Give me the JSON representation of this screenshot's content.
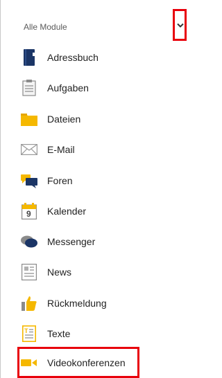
{
  "header": {
    "title": "Alle Module"
  },
  "modules": [
    {
      "label": "Adressbuch",
      "icon": "address-book-icon"
    },
    {
      "label": "Aufgaben",
      "icon": "clipboard-icon"
    },
    {
      "label": "Dateien",
      "icon": "folder-icon"
    },
    {
      "label": "E-Mail",
      "icon": "envelope-icon"
    },
    {
      "label": "Foren",
      "icon": "forum-icon"
    },
    {
      "label": "Kalender",
      "icon": "calendar-icon"
    },
    {
      "label": "Messenger",
      "icon": "chat-bubbles-icon"
    },
    {
      "label": "News",
      "icon": "newspaper-icon"
    },
    {
      "label": "Rückmeldung",
      "icon": "thumbs-up-icon"
    },
    {
      "label": "Texte",
      "icon": "text-document-icon"
    },
    {
      "label": "Videokonferenzen",
      "icon": "video-camera-icon"
    }
  ],
  "calendar_icon_number": "9",
  "colors": {
    "accent_yellow": "#f5b800",
    "dark_blue": "#1b3566",
    "highlight_red": "#e8000b"
  }
}
